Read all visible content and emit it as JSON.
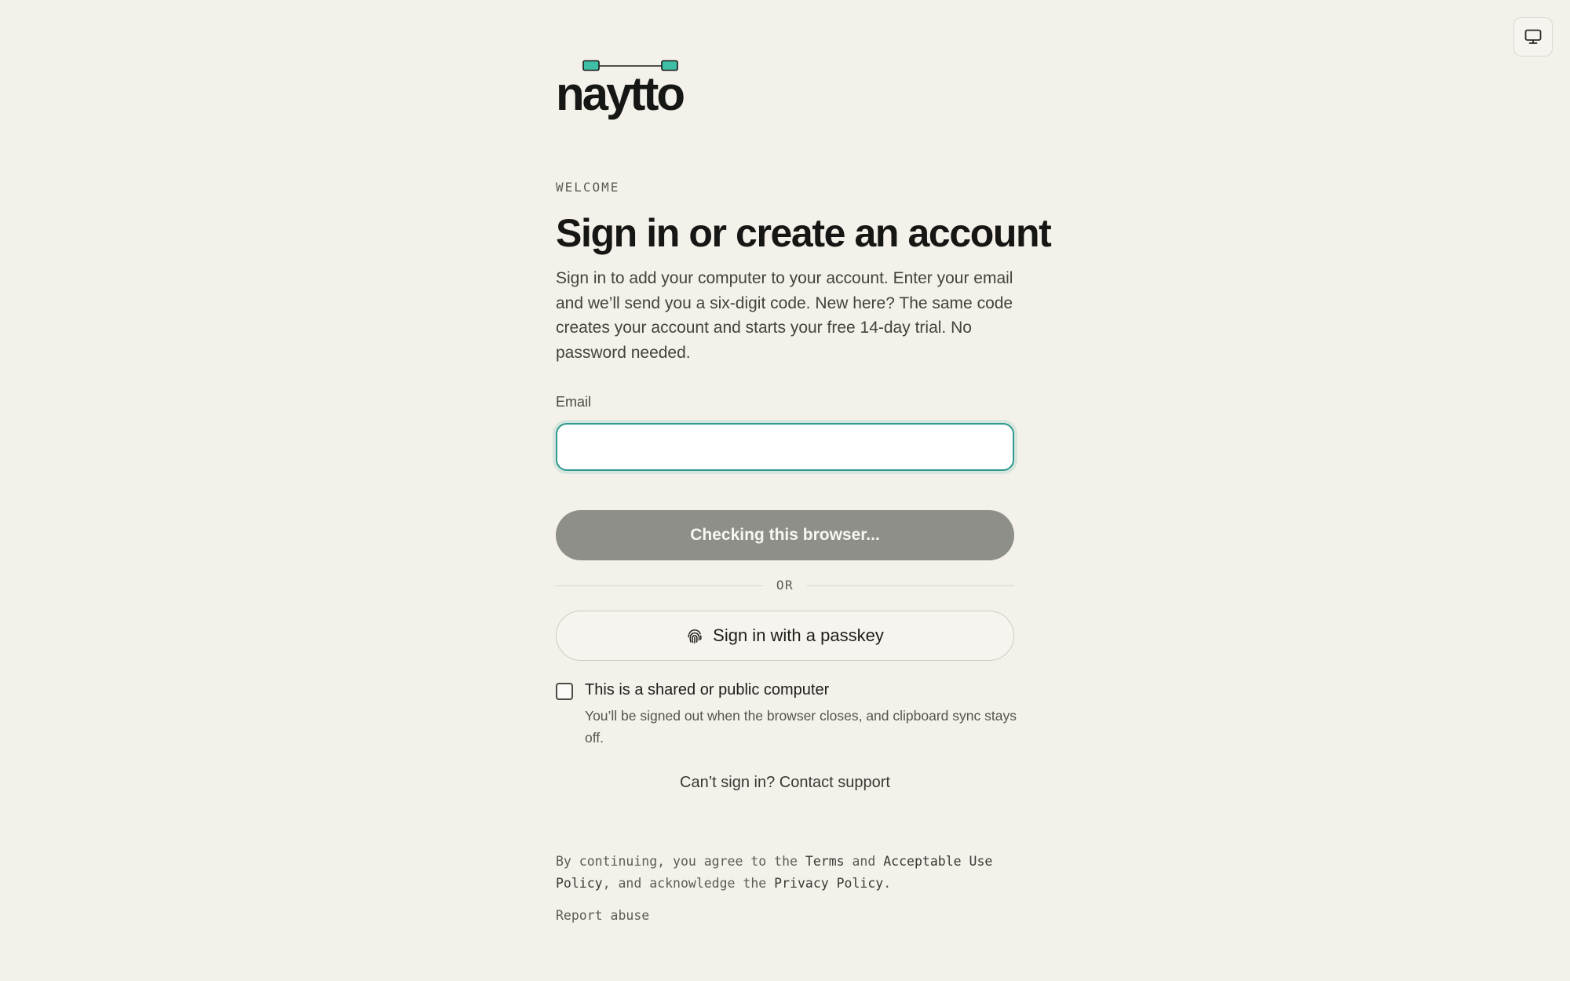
{
  "brand": {
    "name": "naytto",
    "accent": "#2e9a8d"
  },
  "header": {
    "display_toggle_icon": "monitor-icon"
  },
  "welcome": {
    "eyebrow": "WELCOME",
    "title": "Sign in or create an account",
    "intro": "Sign in to add your computer to your account. Enter your email and we’ll send you a six-digit code. New here? The same code creates your account and starts your free 14-day trial. No password needed."
  },
  "form": {
    "email_label": "Email",
    "email_value": "",
    "email_placeholder": "",
    "primary_button": "Checking this browser...",
    "divider_text": "OR",
    "passkey_button": "Sign in with a passkey",
    "passkey_icon": "fingerprint-icon",
    "shared_label": "This is a shared or public computer",
    "shared_checked": false,
    "shared_help": "You’ll be signed out when the browser closes, and clipboard sync stays off."
  },
  "support": {
    "text": "Can’t sign in? Contact support"
  },
  "legal": {
    "prefix": "By continuing, you agree to the ",
    "terms": "Terms",
    "and": " and ",
    "aup": "Acceptable Use Policy",
    "middle": ", and acknowledge the ",
    "privacy": "Privacy Policy",
    "suffix": ".",
    "report": "Report abuse"
  }
}
